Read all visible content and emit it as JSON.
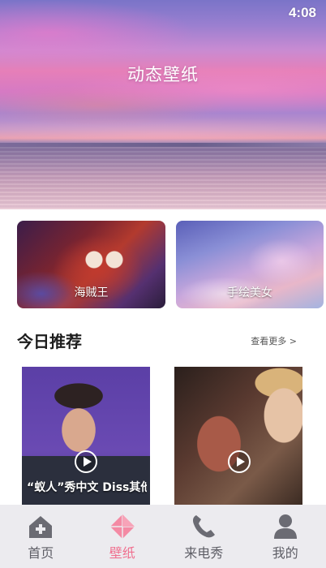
{
  "status_bar": {
    "time": "4:08"
  },
  "hero": {
    "title": "动态壁纸"
  },
  "categories": [
    {
      "label": "海贼王"
    },
    {
      "label": "手绘美女"
    }
  ],
  "recommend": {
    "title": "今日推荐",
    "more_link": "查看更多 >",
    "tiles": [
      {
        "caption": "“蚁人”秀中文 Diss其他超级英雄"
      },
      {
        "caption": ""
      }
    ]
  },
  "bottom_nav": {
    "items": [
      {
        "label": "首页",
        "icon": "home-icon",
        "active": false
      },
      {
        "label": "壁纸",
        "icon": "wallpaper-icon",
        "active": true
      },
      {
        "label": "来电秀",
        "icon": "phone-icon",
        "active": false
      },
      {
        "label": "我的",
        "icon": "profile-icon",
        "active": false
      }
    ],
    "active_color": "#f0708f",
    "inactive_color": "#5e5e66"
  }
}
